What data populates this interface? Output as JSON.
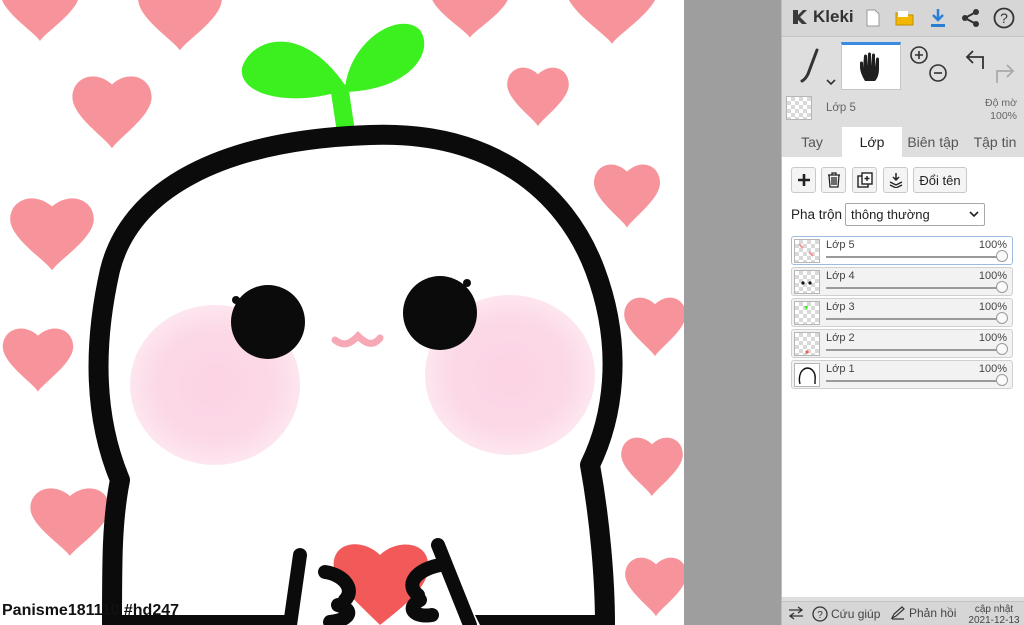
{
  "canvas": {
    "artist_tag": "Panisme181110 #hd247"
  },
  "app": {
    "name": "Kleki"
  },
  "header_icons": [
    "new-file-icon",
    "open-folder-icon",
    "download-icon",
    "share-icon",
    "help-icon"
  ],
  "layer_preview": {
    "name": "Lớp 5",
    "opacity_label": "Độ mờ",
    "opacity_value": "100%"
  },
  "tabs": [
    {
      "label": "Tay",
      "active": false
    },
    {
      "label": "Lớp",
      "active": true
    },
    {
      "label": "Biên tập",
      "active": false
    },
    {
      "label": "Tập tin",
      "active": false
    }
  ],
  "layer_panel": {
    "rename_label": "Đổi tên",
    "blend_label": "Pha trộn",
    "blend_value": "thông thường",
    "layers": [
      {
        "name": "Lớp 5",
        "opacity": "100%",
        "selected": true
      },
      {
        "name": "Lớp 4",
        "opacity": "100%",
        "selected": false
      },
      {
        "name": "Lớp 3",
        "opacity": "100%",
        "selected": false
      },
      {
        "name": "Lớp 2",
        "opacity": "100%",
        "selected": false
      },
      {
        "name": "Lớp 1",
        "opacity": "100%",
        "selected": false
      }
    ]
  },
  "footer": {
    "help_label": "Cứu giúp",
    "feedback_label": "Phản hồi",
    "update_label": "cập nhật",
    "update_date": "2021-12-13"
  },
  "colors": {
    "accent": "#3a8be0",
    "panel_bg": "#dedede",
    "heart": "#f7949b",
    "sprout": "#3cef1e",
    "blush": "#fcd9e7"
  }
}
